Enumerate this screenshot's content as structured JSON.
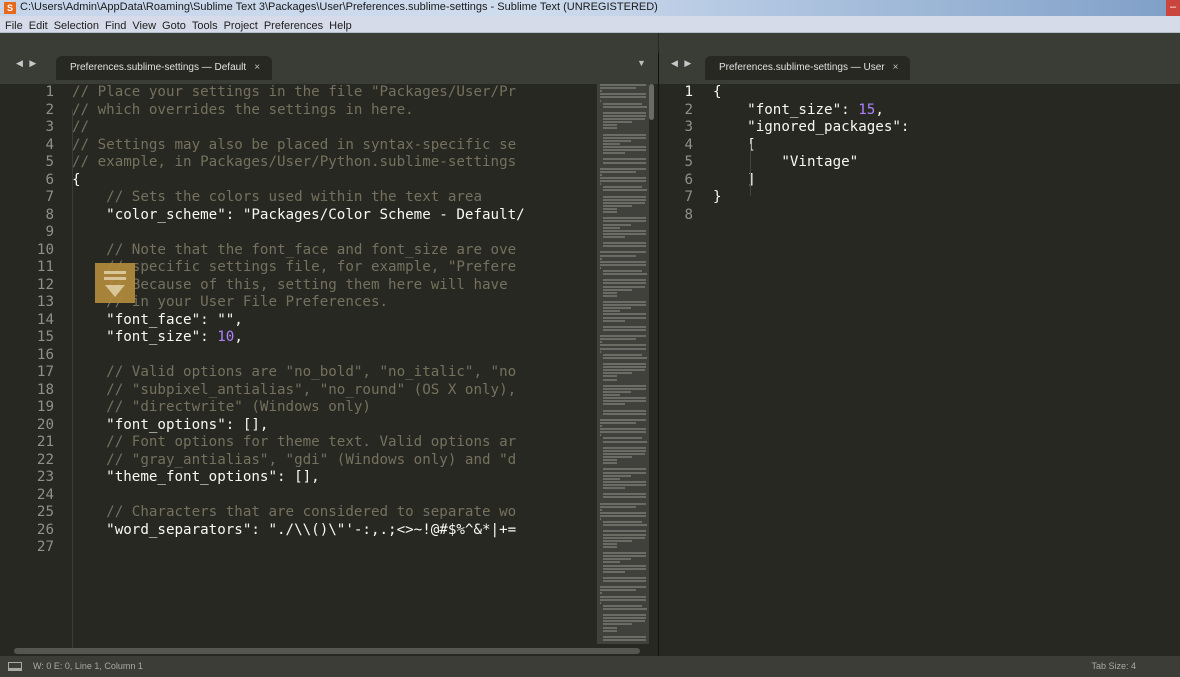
{
  "window": {
    "title": "C:\\Users\\Admin\\AppData\\Roaming\\Sublime Text 3\\Packages\\User\\Preferences.sublime-settings - Sublime Text (UNREGISTERED)",
    "app_icon_glyph": "S",
    "minimize_glyph": "–"
  },
  "menu": [
    "File",
    "Edit",
    "Selection",
    "Find",
    "View",
    "Goto",
    "Tools",
    "Project",
    "Preferences",
    "Help"
  ],
  "left_pane": {
    "nav_arrows": "◀ ▶",
    "tab_label": "Preferences.sublime-settings — Default",
    "tab_close": "×",
    "dropdown_caret": "▼",
    "line_numbers": [
      "1",
      "2",
      "3",
      "4",
      "5",
      "6",
      "7",
      "8",
      "9",
      "10",
      "11",
      "12",
      "13",
      "14",
      "15",
      "16",
      "17",
      "18",
      "19",
      "20",
      "21",
      "22",
      "23",
      "24",
      "25",
      "26",
      "27"
    ],
    "lines": [
      "// Place your settings in the file \"Packages/User/Pr",
      "// which overrides the settings in here.",
      "//",
      "// Settings may also be placed in syntax-specific se",
      "// example, in Packages/User/Python.sublime-settings",
      "{",
      "    // Sets the colors used within the text area",
      "    \"color_scheme\": \"Packages/Color Scheme - Default/",
      "",
      "    // Note that the font_face and font_size are ove",
      "    // specific settings file, for example, \"Prefere",
      "    // Because of this, setting them here will have ",
      "    // in your User File Preferences.",
      "    \"font_face\": \"\",",
      "    \"font_size\": 10,",
      "",
      "    // Valid options are \"no_bold\", \"no_italic\", \"no",
      "    // \"subpixel_antialias\", \"no_round\" (OS X only),",
      "    // \"directwrite\" (Windows only)",
      "    \"font_options\": [],",
      "    // Font options for theme text. Valid options ar",
      "    // \"gray_antialias\", \"gdi\" (Windows only) and \"d",
      "    \"theme_font_options\": [],",
      "",
      "    // Characters that are considered to separate wo",
      "    \"word_separators\": \"./\\\\()\\\"'-:,.;<>~!@#$%^&*|+=",
      ""
    ]
  },
  "right_pane": {
    "nav_arrows": "◀ ▶",
    "tab_label": "Preferences.sublime-settings — User",
    "tab_close": "×",
    "line_numbers": [
      "1",
      "2",
      "3",
      "4",
      "5",
      "6",
      "7",
      "8"
    ],
    "lines": [
      "{",
      "    \"font_size\": 15,",
      "    \"ignored_packages\":",
      "    [",
      "        \"Vintage\"",
      "    ]",
      "}",
      ""
    ]
  },
  "status": {
    "left": "W: 0 E: 0, Line 1, Column 1",
    "right": "Tab Size: 4"
  },
  "colors": {
    "editor_bg": "#272822",
    "comment": "#75715e",
    "number": "#ae81ff",
    "text": "#f8f8f2"
  }
}
